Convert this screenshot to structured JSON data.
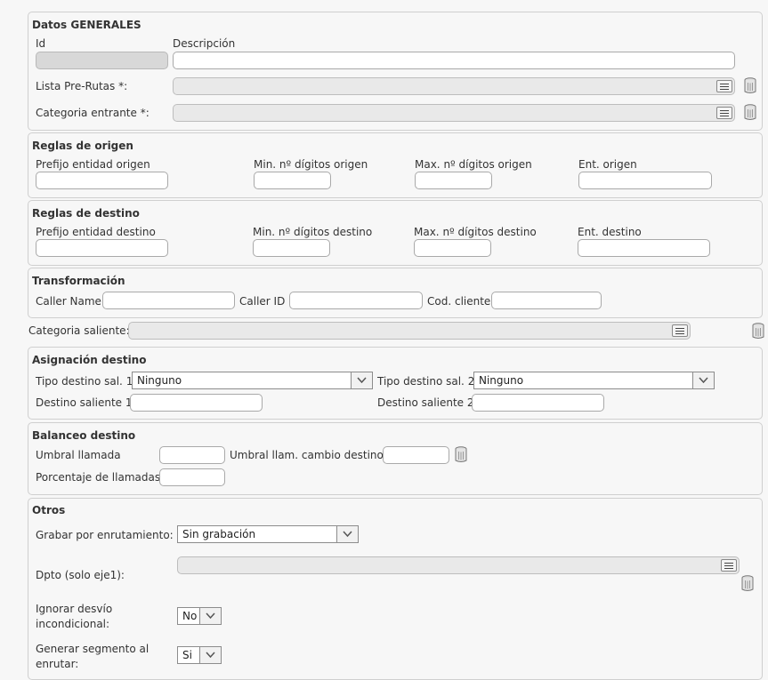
{
  "generales": {
    "legend": "Datos GENERALES",
    "id_label": "Id",
    "descripcion_label": "Descripción",
    "lista_label": "Lista Pre-Rutas *:",
    "categoria_entrante_label": "Categoria entrante *:"
  },
  "origen": {
    "legend": "Reglas de origen",
    "prefijo_label": "Prefijo entidad origen",
    "min_label": "Min. nº dígitos origen",
    "max_label": "Max. nº dígitos origen",
    "ent_label": "Ent. origen"
  },
  "destino": {
    "legend": "Reglas de destino",
    "prefijo_label": "Prefijo entidad destino",
    "min_label": "Min. nº dígitos destino",
    "max_label": "Max. nº dígitos destino",
    "ent_label": "Ent. destino"
  },
  "transformacion": {
    "legend": "Transformación",
    "caller_name_label": "Caller Name",
    "caller_id_label": "Caller ID",
    "cod_cliente_label": "Cod. cliente"
  },
  "categoria_saliente_label": "Categoria saliente:",
  "asignacion": {
    "legend": "Asignación destino",
    "tipo1_label": "Tipo destino sal. 1",
    "tipo1_value": "Ninguno",
    "tipo2_label": "Tipo destino sal. 2",
    "tipo2_value": "Ninguno",
    "destino1_label": "Destino saliente 1",
    "destino2_label": "Destino saliente 2"
  },
  "balanceo": {
    "legend": "Balanceo destino",
    "umbral_label": "Umbral llamada",
    "umbral_cambio_label": "Umbral llam. cambio destino:",
    "porcentaje_label": "Porcentaje de llamadas"
  },
  "otros": {
    "legend": "Otros",
    "grabar_label": "Grabar por enrutamiento:",
    "grabar_value": "Sin grabación",
    "dpto_label": "Dpto (solo eje1):",
    "ignorar_label_1": "Ignorar desvío",
    "ignorar_label_2": "incondicional:",
    "ignorar_value": "No",
    "generar_label_1": "Generar segmento al",
    "generar_label_2": "enrutar:",
    "generar_value": "Si"
  }
}
